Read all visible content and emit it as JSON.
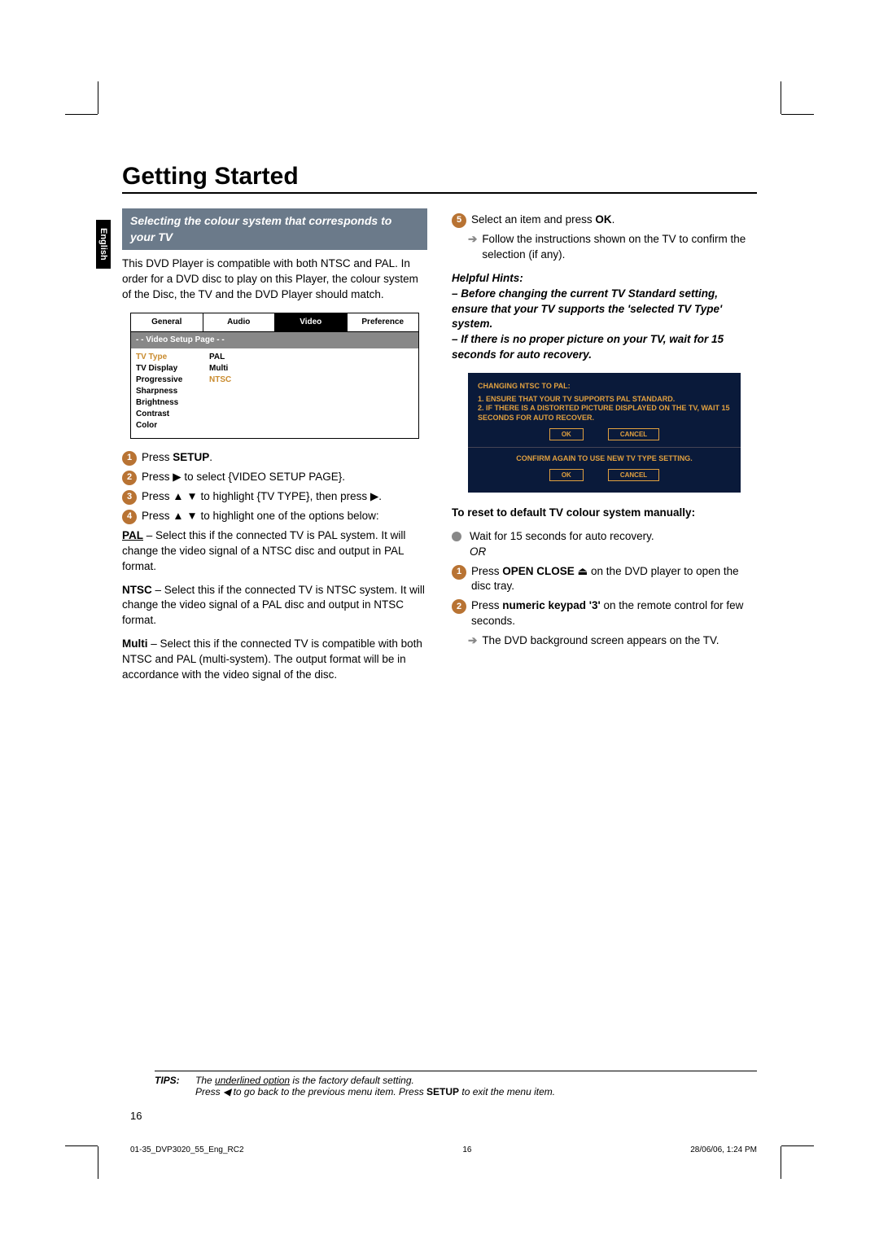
{
  "page_title": "Getting Started",
  "language_tab": "English",
  "subheading": "Selecting the colour system that corresponds to your TV",
  "intro_para": "This DVD Player is compatible with both NTSC and PAL. In order for a DVD disc to play on this Player, the colour system of the Disc, the TV and the DVD Player should match.",
  "osd": {
    "tabs": [
      "General",
      "Audio",
      "Video",
      "Preference"
    ],
    "active_tab": "Video",
    "header": "- -   Video Setup Page   - -",
    "rows": [
      {
        "key": "TV Type",
        "val": "PAL",
        "hl_key": true
      },
      {
        "key": "TV Display",
        "val": "Multi"
      },
      {
        "key": "Progressive",
        "val": "NTSC",
        "hl_val": true
      },
      {
        "key": "Sharpness",
        "val": ""
      },
      {
        "key": "Brightness",
        "val": ""
      },
      {
        "key": "Contrast",
        "val": ""
      },
      {
        "key": "Color",
        "val": ""
      }
    ]
  },
  "steps_left": [
    {
      "n": "1",
      "pre": "Press ",
      "bold": "SETUP",
      "post": "."
    },
    {
      "n": "2",
      "text": "Press ▶ to select {VIDEO SETUP PAGE}."
    },
    {
      "n": "3",
      "text": "Press ▲ ▼ to highlight {TV TYPE}, then press ▶."
    },
    {
      "n": "4",
      "text": "Press ▲ ▼ to highlight one of the options below:"
    }
  ],
  "options": {
    "pal": {
      "label": "PAL",
      "desc": " – Select this if the connected TV is PAL system. It will change the video signal of a NTSC disc and output in PAL format."
    },
    "ntsc": {
      "label": "NTSC",
      "desc": " – Select this if the connected TV is NTSC system. It will change the video signal of a PAL disc and output in NTSC format."
    },
    "multi": {
      "label": "Multi",
      "desc": " – Select this if the connected TV is compatible with both NTSC and PAL (multi-system).  The output format will be in accordance with the video signal of the disc."
    }
  },
  "step5": {
    "n": "5",
    "pre": "Select an item and press ",
    "bold": "OK",
    "post": "."
  },
  "step5_sub": "Follow the instructions shown on the TV to confirm the selection (if any).",
  "hints": {
    "heading": "Helpful Hints:",
    "l1": "–   Before changing the current TV Standard setting, ensure that your TV supports the 'selected TV Type' system.",
    "l2": "–   If there is no proper picture on your TV, wait for 15 seconds for auto recovery."
  },
  "dialog1": {
    "title": "CHANGING NTSC TO PAL:",
    "l1": "1. ENSURE THAT YOUR TV SUPPORTS PAL STANDARD.",
    "l2": "2. IF THERE IS A DISTORTED PICTURE DISPLAYED ON THE TV, WAIT 15 SECONDS FOR AUTO RECOVER.",
    "ok": "OK",
    "cancel": "CANCEL"
  },
  "dialog2": {
    "title": "CONFIRM AGAIN TO USE NEW TV TYPE SETTING.",
    "ok": "OK",
    "cancel": "CANCEL"
  },
  "reset_heading": "To reset to default TV colour system manually:",
  "reset_wait": "Wait for 15 seconds for auto recovery.",
  "reset_or": "OR",
  "reset_step1_pre": "Press ",
  "reset_step1_bold": "OPEN CLOSE",
  "reset_step1_post": " ⏏ on the DVD player to open the disc tray.",
  "reset_step2_pre": "Press ",
  "reset_step2_bold": "numeric keypad '3'",
  "reset_step2_post": " on the remote control for few seconds.",
  "reset_step2_sub": "The DVD background screen appears on the TV.",
  "tips": {
    "label": "TIPS:",
    "l1a": "The ",
    "l1u": "underlined option",
    "l1b": " is the factory default setting.",
    "l2a": "Press ◀ to go back to the previous menu item. Press ",
    "l2b": "SETUP",
    "l2c": " to exit the menu item."
  },
  "page_number": "16",
  "footer_file": "01-35_DVP3020_55_Eng_RC2",
  "footer_page": "16",
  "footer_date": "28/06/06, 1:24 PM"
}
